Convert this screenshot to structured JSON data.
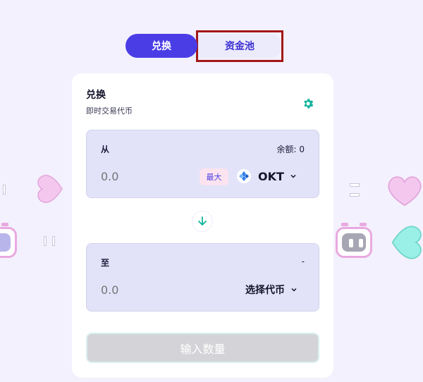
{
  "tabs": {
    "swap_label": "兑换",
    "pool_label": "资金池"
  },
  "card": {
    "title": "兑换",
    "subtitle": "即时交易代币"
  },
  "from": {
    "label": "从",
    "balance_text": "余额: 0",
    "amount_placeholder": "0.0",
    "max_label": "最大",
    "token": "OKT"
  },
  "to": {
    "label": "至",
    "right_text": "-",
    "amount_placeholder": "0.0",
    "select_label": "选择代币"
  },
  "submit_label": "输入数量",
  "icons": {
    "settings": "gear-icon",
    "swap_direction": "arrow-down-icon",
    "token": "okt-token-icon",
    "dropdown": "chevron-down-icon"
  },
  "colors": {
    "primary": "#4a3de6",
    "accent": "#10b49c",
    "highlight": "#a31818"
  }
}
